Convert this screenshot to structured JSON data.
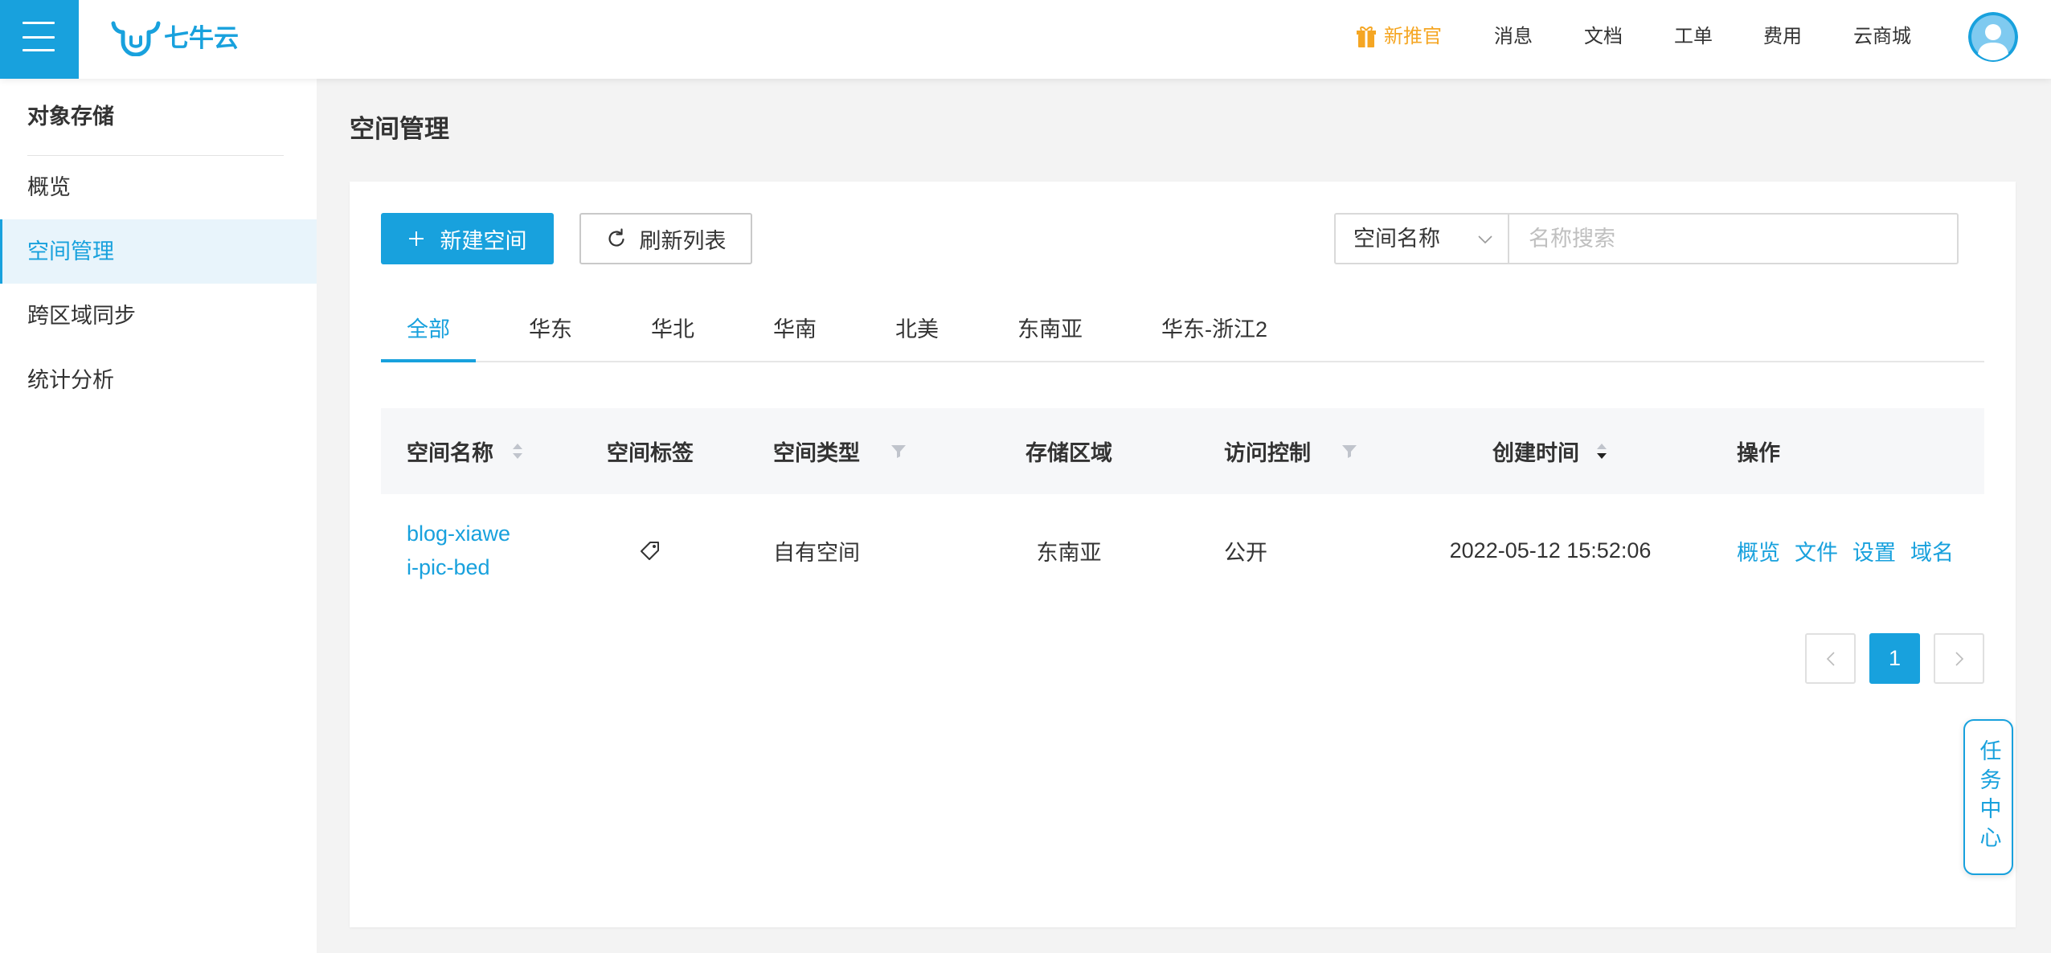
{
  "header": {
    "menu_icon": "hamburger-menu-icon",
    "logo": {
      "icon": "qiniu-logo-icon",
      "text": "七牛云"
    },
    "nav": [
      {
        "label": "新推官",
        "icon": "gift-icon"
      },
      {
        "label": "消息"
      },
      {
        "label": "文档"
      },
      {
        "label": "工单"
      },
      {
        "label": "费用"
      },
      {
        "label": "云商城"
      }
    ],
    "avatar_icon": "user-avatar-icon"
  },
  "sidebar": {
    "title": "对象存储",
    "items": [
      {
        "label": "概览",
        "active": false
      },
      {
        "label": "空间管理",
        "active": true
      },
      {
        "label": "跨区域同步",
        "active": false
      },
      {
        "label": "统计分析",
        "active": false
      }
    ]
  },
  "main": {
    "title": "空间管理",
    "toolbar": {
      "create_label": "新建空间",
      "create_icon": "plus-icon",
      "refresh_label": "刷新列表",
      "refresh_icon": "refresh-icon",
      "search_field": "空间名称",
      "search_field_icon": "chevron-down-icon",
      "search_placeholder": "名称搜索",
      "search_value": ""
    },
    "tabs": [
      {
        "label": "全部",
        "active": true
      },
      {
        "label": "华东",
        "active": false
      },
      {
        "label": "华北",
        "active": false
      },
      {
        "label": "华南",
        "active": false
      },
      {
        "label": "北美",
        "active": false
      },
      {
        "label": "东南亚",
        "active": false
      },
      {
        "label": "华东-浙江2",
        "active": false
      }
    ],
    "table": {
      "columns": [
        {
          "label": "空间名称",
          "icon": "sort-icon"
        },
        {
          "label": "空间标签"
        },
        {
          "label": "空间类型",
          "icon": "filter-icon"
        },
        {
          "label": "存储区域"
        },
        {
          "label": "访问控制",
          "icon": "filter-icon"
        },
        {
          "label": "创建时间",
          "icon": "sort-desc-icon"
        },
        {
          "label": "操作"
        }
      ],
      "rows": [
        {
          "name": "blog-xiawei-pic-bed",
          "tag_icon": "tag-icon",
          "type": "自有空间",
          "region": "东南亚",
          "access": "公开",
          "created": "2022-05-12 15:52:06",
          "actions": [
            "概览",
            "文件",
            "设置",
            "域名"
          ]
        }
      ]
    },
    "pagination": {
      "prev_icon": "chevron-left-icon",
      "current": "1",
      "next_icon": "chevron-right-icon"
    }
  },
  "task_center": {
    "label": "任务中心"
  },
  "colors": {
    "primary": "#18a1dd",
    "promo": "#f5a623",
    "text": "#333333",
    "page_bg": "#f3f3f3",
    "active_item_bg": "#e8f4fb",
    "table_header_bg": "#f6f7f9"
  }
}
